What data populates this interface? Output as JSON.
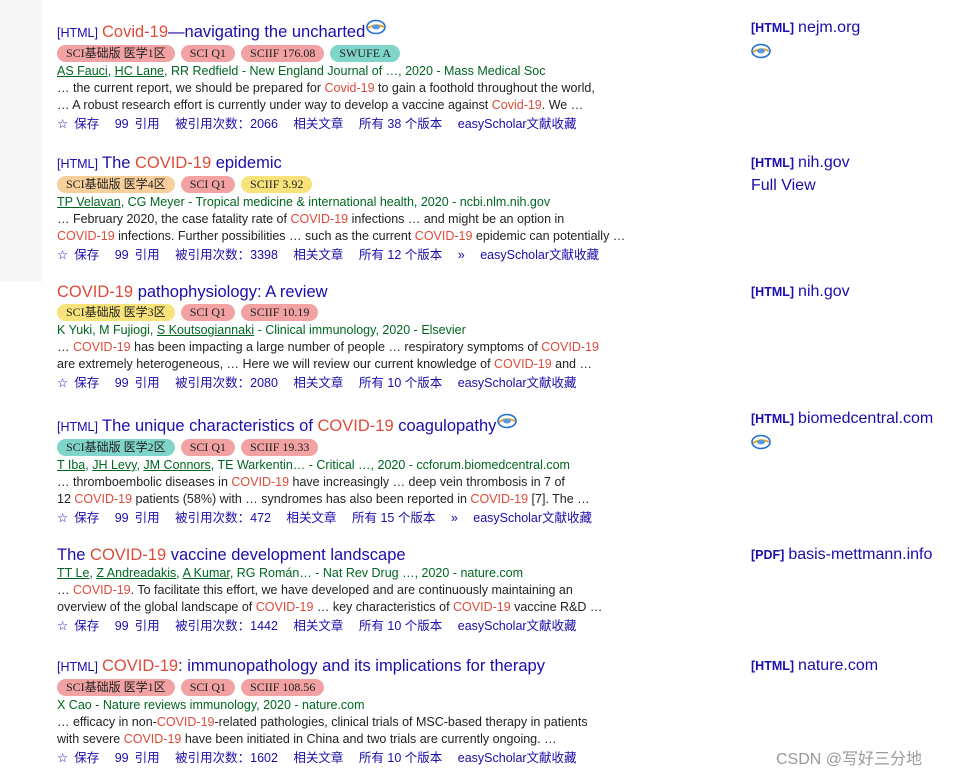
{
  "results": [
    {
      "type": "[HTML]",
      "title_parts": [
        "",
        "Covid-19",
        "—navigating the uncharted"
      ],
      "badges": [
        {
          "label": "SCI基础版 医学1区",
          "color": "#f2a2a2"
        },
        {
          "label": "SCI Q1",
          "color": "#f2a2a2"
        },
        {
          "label": "SCIIF 176.08",
          "color": "#f2a2a2"
        },
        {
          "label": "SWUFE A",
          "color": "#7fd5c9"
        }
      ],
      "authors_linked": [
        "AS Fauci",
        "HC Lane"
      ],
      "authors_rest": "RR Redfield - New England Journal of …, 2020 - Mass Medical Soc",
      "snippet1": [
        "… the current report, we should be prepared for ",
        "Covid-19",
        " to gain a foothold throughout the world,"
      ],
      "snippet2": [
        "… A robust research effort is currently under way to develop a vaccine against ",
        "Covid-19",
        ". We …"
      ],
      "cited": "被引用次数：2066",
      "versions": "所有 38 个版本",
      "side_type": "[HTML]",
      "side_domain": "nejm.org"
    },
    {
      "type": "[HTML]",
      "title_parts": [
        "The ",
        "COVID-19",
        " epidemic"
      ],
      "badges": [
        {
          "label": "SCI基础版 医学4区",
          "color": "#f7cf9a"
        },
        {
          "label": "SCI Q1",
          "color": "#f2a2a2"
        },
        {
          "label": "SCIIF 3.92",
          "color": "#f8e27a"
        }
      ],
      "authors_linked": [
        "TP Velavan"
      ],
      "authors_rest": "CG Meyer - Tropical medicine & international health, 2020 - ncbi.nlm.nih.gov",
      "snippet1": [
        "… February 2020, the case fatality rate of ",
        "COVID-19",
        " infections … and might be an option in"
      ],
      "snippet2": [
        "",
        "COVID-19",
        " infections. Further possibilities … such as the current ",
        "COVID-19",
        " epidemic can potentially …"
      ],
      "cited": "被引用次数：3398",
      "versions": "所有 12 个版本",
      "side_type": "[HTML]",
      "side_domain": "nih.gov",
      "side_extra": "Full View"
    },
    {
      "type": "",
      "title_parts": [
        "",
        "COVID-19",
        " pathophysiology: A review"
      ],
      "badges": [
        {
          "label": "SCI基础版 医学3区",
          "color": "#f8e27a"
        },
        {
          "label": "SCI Q1",
          "color": "#f2a2a2"
        },
        {
          "label": "SCIIF 10.19",
          "color": "#f2a2a2"
        }
      ],
      "authors_linked": [
        "S Koutsogiannaki"
      ],
      "authors_plain": "K Yuki, M Fujiogi, ",
      "authors_rest": "- Clinical immunology, 2020 - Elsevier",
      "snippet1": [
        "… ",
        "COVID-19",
        " has been impacting a large number of people … respiratory symptoms of ",
        "COVID-19"
      ],
      "snippet2": [
        "are extremely heterogeneous, … Here we will review our current knowledge of ",
        "COVID-19",
        " and …"
      ],
      "cited": "被引用次数：2080",
      "versions": "所有 10 个版本",
      "side_type": "[HTML]",
      "side_domain": "nih.gov"
    },
    {
      "type": "[HTML]",
      "title_parts": [
        "The unique characteristics of ",
        "COVID-19",
        " coagulopathy"
      ],
      "badges": [
        {
          "label": "SCI基础版 医学2区",
          "color": "#7fd5c9"
        },
        {
          "label": "SCI Q1",
          "color": "#f2a2a2"
        },
        {
          "label": "SCIIF 19.33",
          "color": "#f2a2a2"
        }
      ],
      "authors_linked": [
        "T Iba",
        "JH Levy",
        "JM Connors"
      ],
      "authors_rest": "TE Warkentin… - Critical …, 2020 - ccforum.biomedcentral.com",
      "snippet1": [
        "… thromboembolic diseases in ",
        "COVID-19",
        " have increasingly … deep vein thrombosis in 7 of"
      ],
      "snippet2": [
        "12 ",
        "COVID-19",
        " patients (58%) with … syndromes has also been reported in ",
        "COVID-19",
        " [7]. The …"
      ],
      "cited": "被引用次数：472",
      "versions": "所有 15 个版本",
      "side_type": "[HTML]",
      "side_domain": "biomedcentral.com"
    },
    {
      "type": "",
      "title_parts": [
        "The ",
        "COVID-19",
        " vaccine development landscape"
      ],
      "badges": [],
      "authors_linked": [
        "TT Le",
        "Z Andreadakis",
        "A Kumar"
      ],
      "authors_rest": "RG Román… - Nat Rev Drug …, 2020 - nature.com",
      "snippet1": [
        "… ",
        "COVID-19",
        ". To facilitate this effort, we have developed and are continuously maintaining an"
      ],
      "snippet2": [
        "overview of the global landscape of ",
        "COVID-19",
        " … key characteristics of ",
        "COVID-19",
        " vaccine R&D …"
      ],
      "cited": "被引用次数：1442",
      "versions": "所有 10 个版本",
      "side_type": "[PDF]",
      "side_domain": "basis-mettmann.info"
    },
    {
      "type": "[HTML]",
      "title_parts": [
        "",
        "COVID-19",
        ": immunopathology and its implications for therapy"
      ],
      "badges": [
        {
          "label": "SCI基础版 医学1区",
          "color": "#f2a2a2"
        },
        {
          "label": "SCI Q1",
          "color": "#f2a2a2"
        },
        {
          "label": "SCIIF 108.56",
          "color": "#f2a2a2"
        }
      ],
      "authors_linked": [],
      "authors_rest": "X Cao - Nature reviews immunology, 2020 - nature.com",
      "snippet1": [
        "… efficacy in non-",
        "COVID-19",
        "-related pathologies, clinical trials of MSC-based therapy in patients"
      ],
      "snippet2": [
        "with severe ",
        "COVID-19",
        " have been initiated in China and two trials are currently ongoing. …"
      ],
      "cited": "被引用次数：1602",
      "versions": "所有 10 个版本",
      "side_type": "[HTML]",
      "side_domain": "nature.com"
    }
  ],
  "actions": {
    "save": "保存",
    "cite": "引用",
    "related": "相关文章",
    "easyscholar": "easyScholar文献收藏",
    "star_icon": "☆",
    "cite_icon": "99",
    "more_icon": "»"
  },
  "watermark": "CSDN @写好三分地"
}
